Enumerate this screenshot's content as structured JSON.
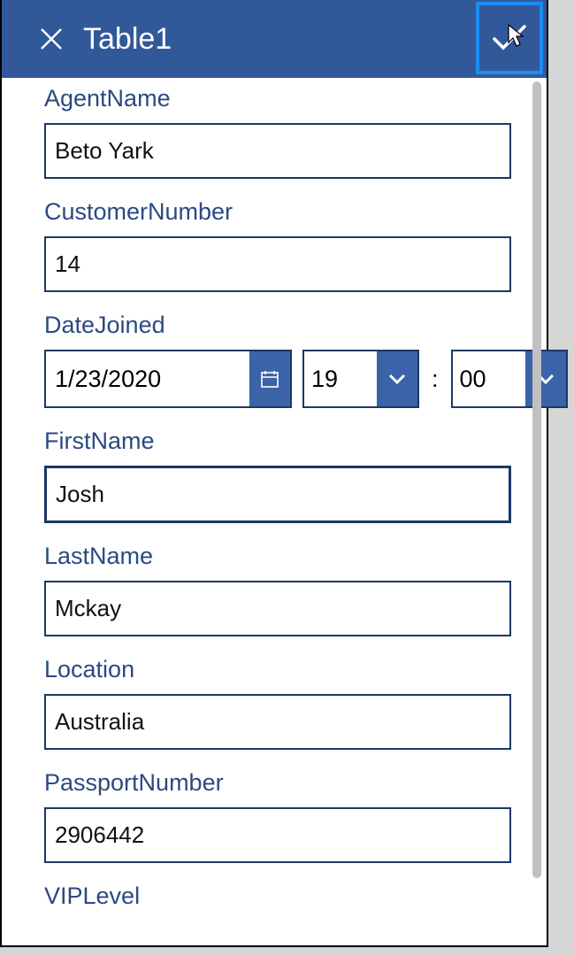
{
  "header": {
    "title": "Table1"
  },
  "fields": {
    "agent_name": {
      "label": "AgentName",
      "value": "Beto Yark"
    },
    "customer_number": {
      "label": "CustomerNumber",
      "value": "14"
    },
    "date_joined": {
      "label": "DateJoined",
      "date": "1/23/2020",
      "hour": "19",
      "minute": "00",
      "sep": ":"
    },
    "first_name": {
      "label": "FirstName",
      "value": "Josh"
    },
    "last_name": {
      "label": "LastName",
      "value": "Mckay"
    },
    "location": {
      "label": "Location",
      "value": "Australia"
    },
    "passport_number": {
      "label": "PassportNumber",
      "value": "2906442"
    },
    "vip_level": {
      "label": "VIPLevel"
    }
  }
}
